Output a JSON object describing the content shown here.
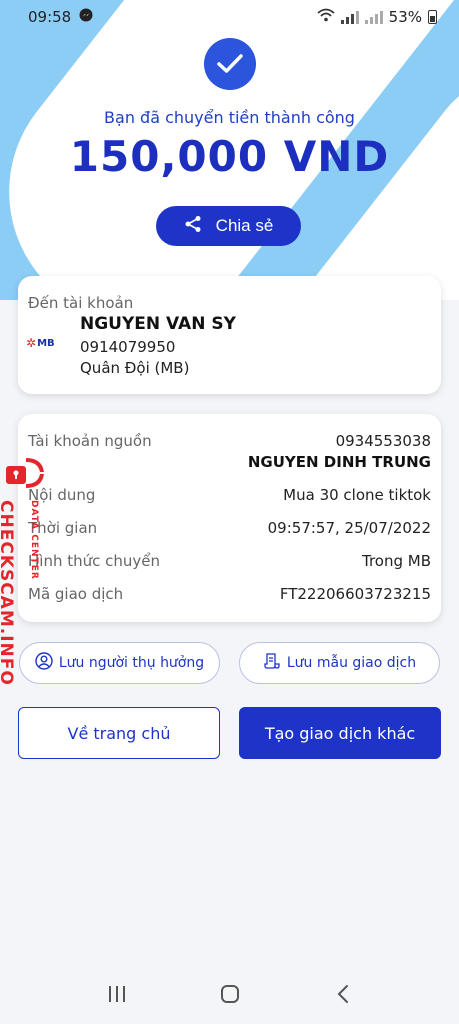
{
  "status_bar": {
    "time": "09:58",
    "battery": "53%",
    "icons": [
      "messenger-icon",
      "wifi-icon",
      "signal-icon",
      "battery-icon"
    ]
  },
  "result": {
    "success_text": "Bạn đã chuyển tiền thành công",
    "amount": "150,000 VND",
    "share_label": "Chia sẻ"
  },
  "destination": {
    "label": "Đến tài khoản",
    "bank_logo_text": "MB",
    "name": "NGUYEN VAN SY",
    "account": "0914079950",
    "bank": "Quân Đội (MB)"
  },
  "details": {
    "source_label": "Tài khoản nguồn",
    "source_account": "0934553038",
    "source_name": "NGUYEN DINH TRUNG",
    "content_label": "Nội dung",
    "content_value": "Mua 30 clone tiktok",
    "time_label": "Thời gian",
    "time_value": "09:57:57, 25/07/2022",
    "method_label": "Hình thức chuyển",
    "method_value": "Trong MB",
    "txn_label": "Mã giao dịch",
    "txn_value": "FT22206603723215"
  },
  "actions": {
    "save_recipient": "Lưu người thụ hưởng",
    "save_template": "Lưu mẫu giao dịch",
    "home": "Về trang chủ",
    "new_transaction": "Tạo giao dịch khác"
  },
  "watermark": {
    "main": "CHECKSCAM.INFO",
    "sub": "DATA CENTER"
  },
  "colors": {
    "primary": "#1e34c8",
    "background_accent": "#8ccdf6",
    "watermark": "#e3262b"
  }
}
